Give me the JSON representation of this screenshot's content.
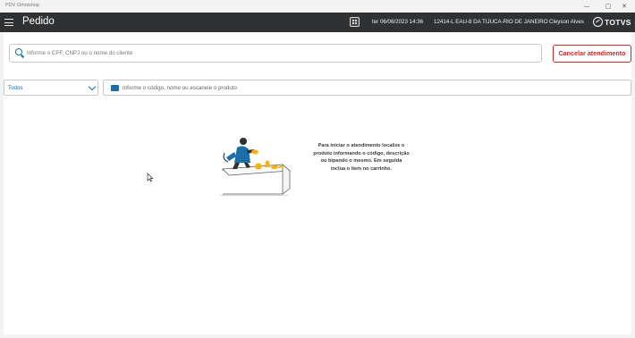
{
  "window": {
    "title": "PDV Omnishop",
    "controls": {
      "minimize": "—",
      "restore": "▢",
      "close": "✕"
    }
  },
  "appbar": {
    "page_title": "Pedido",
    "datetime": "ter 06/06/2023 14:36",
    "store": "12414-L EAU-8 DA TIJUCA-RIO DE JANEIRO",
    "user": "Cleyson Alves",
    "brand": "TOTVS",
    "icons": {
      "menu": "hamburger-icon",
      "calculator": "calculator-icon"
    }
  },
  "client_search": {
    "placeholder": "Informe o CPF, CNPJ ou o nome do cliente",
    "icon": "search-icon"
  },
  "cancel_button": {
    "label": "Cancelar atendimento",
    "color": "#c62828"
  },
  "filter": {
    "selected": "Todos"
  },
  "product_search": {
    "placeholder": "Informe o código, nome ou escaneie o produto",
    "icon": "barcode-icon"
  },
  "empty_state": {
    "message": "Para iniciar o atendimento localize o produto informando o código, descrição ou bipando o mesmo. Em seguida inclua o item no carrinho."
  },
  "colors": {
    "appbar": "#2f3133",
    "accent": "#1b6ea8",
    "danger": "#c62828",
    "illustration_yellow": "#f5b01a",
    "illustration_blue": "#1b6ea8"
  }
}
